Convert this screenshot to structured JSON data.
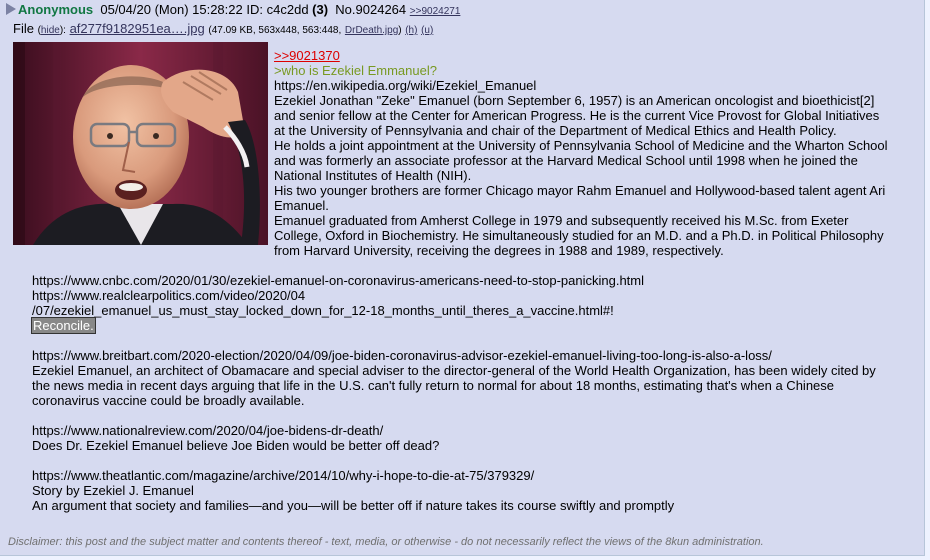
{
  "intro": {
    "name": "Anonymous",
    "datetime": "05/04/20 (Mon) 15:28:22",
    "id_label": "ID:",
    "id_value": "c4c2dd",
    "id_count": "(3)",
    "post_number": "No.9024264",
    "backlink": ">>9024271"
  },
  "file": {
    "label": "File",
    "hide_text": "hide",
    "filename": "af277f9182951ea….jpg",
    "details_before": "(47.09 KB, 563x448, 563:448,",
    "original_name": "DrDeath.jpg",
    "h_link": "(h)",
    "u_link": "(u)"
  },
  "body": {
    "reply_ref": ">>9021370",
    "greentext": ">who is Ezekiel Emmanuel?",
    "wiki_url": "https://en.wikipedia.org/wiki/Ezekiel_Emanuel",
    "para1": "Ezekiel Jonathan \"Zeke\" Emanuel (born September 6, 1957) is an American oncologist and bioethicist[2] and senior fellow at the Center for American Progress. He is the current Vice Provost for Global Initiatives at the University of Pennsylvania and chair of the Department of Medical Ethics and Health Policy.",
    "para2": "He holds a joint appointment at the University of Pennsylvania School of Medicine and the Wharton School and was formerly an associate professor at the Harvard Medical School until 1998 when he joined the National Institutes of Health (NIH).",
    "para3": "His two younger brothers are former Chicago mayor Rahm Emanuel and Hollywood-based talent agent Ari Emanuel.",
    "para4": "Emanuel graduated from Amherst College in 1979 and subsequently received his M.Sc. from Exeter College, Oxford in Biochemistry. He simultaneously studied for an M.D. and a Ph.D. in Political Philosophy from Harvard University, receiving the degrees in 1988 and 1989, respectively.",
    "url_cnbc": "https://www.cnbc.com/2020/01/30/ezekiel-emanuel-on-coronavirus-americans-need-to-stop-panicking.html",
    "url_rcp_1": "https://www.realclearpolitics.com/video/2020/04",
    "url_rcp_2": "/07/ezekiel_emanuel_us_must_stay_locked_down_for_12-18_months_until_theres_a_vaccine.html#!",
    "highlight": "Reconcile.",
    "url_breitbart": "https://www.breitbart.com/2020-election/2020/04/09/joe-biden-coronavirus-advisor-ezekiel-emanuel-living-too-long-is-also-a-loss/",
    "para_breitbart": "Ezekiel Emanuel, an architect of Obamacare and special adviser to the director-general of the World Health Organization, has been widely cited by the news media in recent days arguing that life in the U.S. can't fully return to normal for about 18 months, estimating that's when a Chinese coronavirus vaccine could be broadly available.",
    "url_nr": "https://www.nationalreview.com/2020/04/joe-bidens-dr-death/",
    "para_nr": "Does Dr. Ezekiel Emanuel believe Joe Biden would be better off dead?",
    "url_atlantic": "https://www.theatlantic.com/magazine/archive/2014/10/why-i-hope-to-die-at-75/379329/",
    "atlantic_byline": "Story by Ezekiel J. Emanuel",
    "atlantic_sub": "An argument that society and families—and you—will be better off if nature takes its course swiftly and promptly"
  },
  "disclaimer": "Disclaimer: this post and the subject matter and contents thereof - text, media, or otherwise - do not necessarily reflect the views of the 8kun administration.",
  "colors": {
    "post_bg": "#d6daf0",
    "name": "#117743",
    "greentext": "#789922",
    "reply_ref": "#dd0000",
    "link": "#34345c"
  }
}
